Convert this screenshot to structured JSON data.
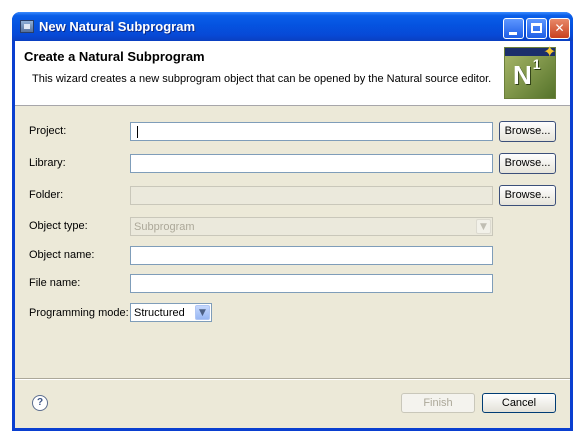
{
  "window": {
    "title": "New Natural Subprogram"
  },
  "header": {
    "title": "Create a Natural Subprogram",
    "description": "This wizard creates a new subprogram object that can be opened by the Natural source editor.",
    "logo_text": "N",
    "logo_sup": "1"
  },
  "form": {
    "project_label": "Project:",
    "project_value": "",
    "library_label": "Library:",
    "library_value": "",
    "folder_label": "Folder:",
    "folder_value": "",
    "browse_label": "Browse...",
    "object_type_label": "Object type:",
    "object_type_value": "Subprogram",
    "object_name_label": "Object name:",
    "object_name_value": "",
    "file_name_label": "File name:",
    "file_name_value": "",
    "programming_mode_label": "Programming mode:",
    "programming_mode_value": "Structured"
  },
  "footer": {
    "help_symbol": "?",
    "finish_label": "Finish",
    "cancel_label": "Cancel"
  }
}
